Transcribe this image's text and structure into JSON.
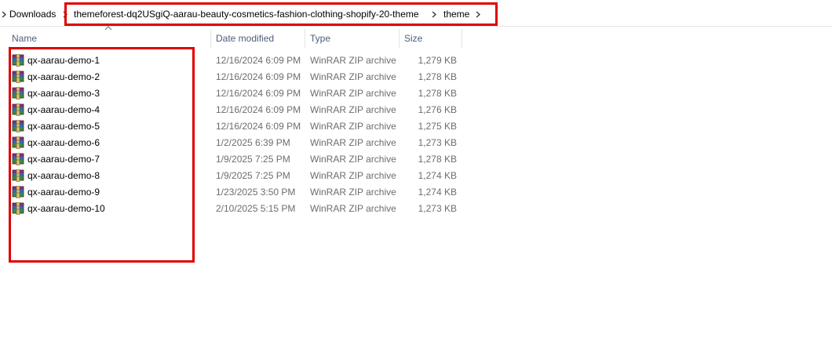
{
  "breadcrumb": {
    "items": [
      "Downloads",
      "themeforest-dq2USgiQ-aarau-beauty-cosmetics-fashion-clothing-shopify-20-theme",
      "theme"
    ]
  },
  "columns": {
    "name": "Name",
    "date": "Date modified",
    "type": "Type",
    "size": "Size"
  },
  "files": [
    {
      "name": "qx-aarau-demo-1",
      "date": "12/16/2024 6:09 PM",
      "type": "WinRAR ZIP archive",
      "size": "1,279 KB"
    },
    {
      "name": "qx-aarau-demo-2",
      "date": "12/16/2024 6:09 PM",
      "type": "WinRAR ZIP archive",
      "size": "1,278 KB"
    },
    {
      "name": "qx-aarau-demo-3",
      "date": "12/16/2024 6:09 PM",
      "type": "WinRAR ZIP archive",
      "size": "1,278 KB"
    },
    {
      "name": "qx-aarau-demo-4",
      "date": "12/16/2024 6:09 PM",
      "type": "WinRAR ZIP archive",
      "size": "1,276 KB"
    },
    {
      "name": "qx-aarau-demo-5",
      "date": "12/16/2024 6:09 PM",
      "type": "WinRAR ZIP archive",
      "size": "1,275 KB"
    },
    {
      "name": "qx-aarau-demo-6",
      "date": "1/2/2025 6:39 PM",
      "type": "WinRAR ZIP archive",
      "size": "1,273 KB"
    },
    {
      "name": "qx-aarau-demo-7",
      "date": "1/9/2025 7:25 PM",
      "type": "WinRAR ZIP archive",
      "size": "1,278 KB"
    },
    {
      "name": "qx-aarau-demo-8",
      "date": "1/9/2025 7:25 PM",
      "type": "WinRAR ZIP archive",
      "size": "1,274 KB"
    },
    {
      "name": "qx-aarau-demo-9",
      "date": "1/23/2025 3:50 PM",
      "type": "WinRAR ZIP archive",
      "size": "1,274 KB"
    },
    {
      "name": "qx-aarau-demo-10",
      "date": "2/10/2025 5:15 PM",
      "type": "WinRAR ZIP archive",
      "size": "1,273 KB"
    }
  ],
  "icons": {
    "chevron": "chevron-right-icon",
    "sort": "sort-ascending-icon",
    "file": "winrar-zip-archive-icon"
  },
  "colors": {
    "highlight": "#e00000",
    "header_text": "#4c607a",
    "meta_text": "#6d6d6d"
  }
}
